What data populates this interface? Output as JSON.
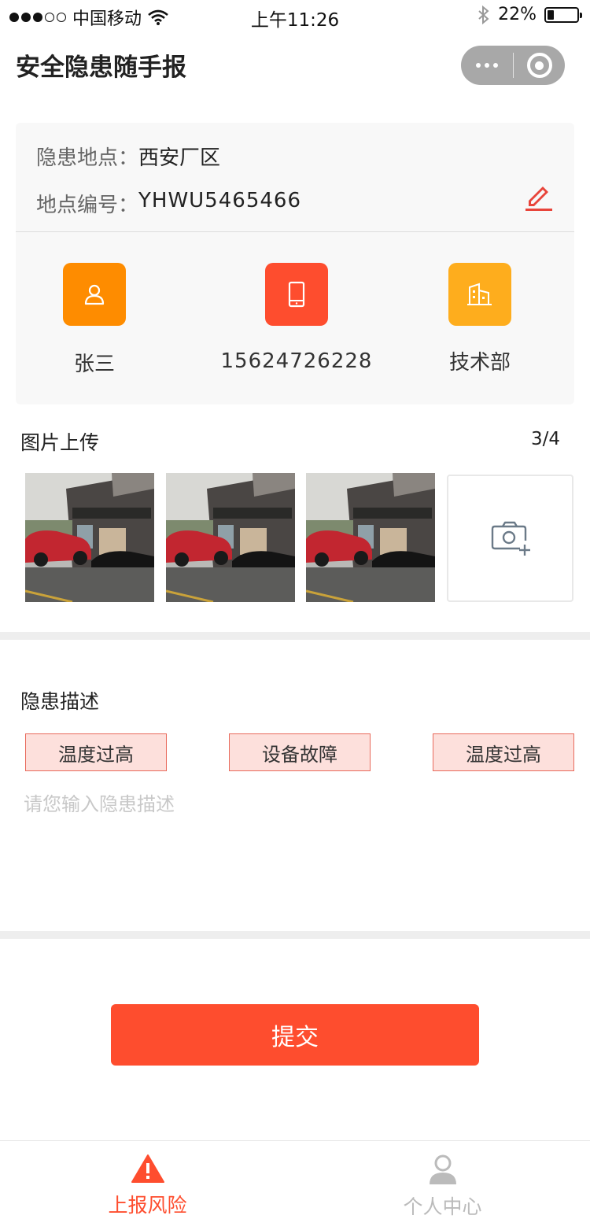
{
  "status_bar": {
    "carrier": "中国移动",
    "time": "上午11:26",
    "battery": "22%",
    "battery_level": 0.22
  },
  "nav": {
    "title": "安全隐患随手报"
  },
  "info": {
    "location_label": "隐患地点：",
    "location_value": "西安厂区",
    "code_label": "地点编号：",
    "code_value": "YHWU5465466"
  },
  "contacts": [
    {
      "icon": "person-icon",
      "text": "张三",
      "color": "#fe8c00"
    },
    {
      "icon": "phone-icon",
      "text": "15624726228",
      "color": "#fe4d2e"
    },
    {
      "icon": "building-icon",
      "text": "技术部",
      "color": "#fead1d"
    }
  ],
  "upload": {
    "title": "图片上传",
    "count": "3/4"
  },
  "description": {
    "title": "隐患描述",
    "tags": [
      "温度过高",
      "设备故障",
      "温度过高"
    ],
    "placeholder": "请您输入隐患描述"
  },
  "submit_label": "提交",
  "tabs": [
    {
      "label": "上报风险",
      "icon": "warning-icon",
      "active": true
    },
    {
      "label": "个人中心",
      "icon": "user-icon",
      "active": false
    }
  ],
  "colors": {
    "accent": "#fe4d2e",
    "orange": "#fe8c00",
    "amber": "#fead1d",
    "tag_bg": "#fde0dc",
    "inactive": "#bbbbbb"
  }
}
